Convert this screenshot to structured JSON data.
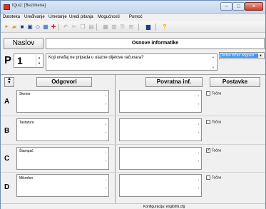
{
  "window": {
    "title": "iQuiz: [Bezimena]",
    "controls": [
      "minimize-icon",
      "maximize-icon",
      "close-icon"
    ]
  },
  "menu": [
    "Datoteka",
    "Uređivanje",
    "Umetanje",
    "Uredi pitanja",
    "Mogućnosti",
    "Pomoć"
  ],
  "toolbar": {
    "icons": [
      "new-icon",
      "open-icon",
      "save-icon",
      "save-as-icon",
      "insert-icon",
      "settings-icon",
      "delete-icon",
      "undo-icon",
      "cut-icon",
      "copy-icon",
      "paste-icon",
      "grid-icon",
      "print-icon",
      "export-icon",
      "quiz-run-icon",
      "help-icon"
    ]
  },
  "header": {
    "naslov_label": "Naslov",
    "title_value": "Osnove informatike"
  },
  "question": {
    "label": "P",
    "number": "1",
    "text": "Koji uređaj ne pripada u ulazne dijelove računara?",
    "type_selected": "Jedan točan odgovor"
  },
  "columns": {
    "answers": "Odgovori",
    "feedback": "Povratna inf.",
    "settings": "Postavke"
  },
  "answers": [
    {
      "letter": "A",
      "text": "Skener",
      "correct_label": "Točno",
      "checked": false
    },
    {
      "letter": "B",
      "text": "Tastatura",
      "correct_label": "Točno",
      "checked": false
    },
    {
      "letter": "C",
      "text": "Štampač",
      "correct_label": "Točno",
      "checked": true
    },
    {
      "letter": "D",
      "text": "Mikrofon",
      "correct_label": "Točno",
      "checked": false
    }
  ],
  "status": {
    "config_text": "Konfiguracija: english6.cfg"
  },
  "colors": {
    "selection": "#3399ff",
    "titlebar": "#c7d8ee",
    "close": "#c5432c"
  }
}
